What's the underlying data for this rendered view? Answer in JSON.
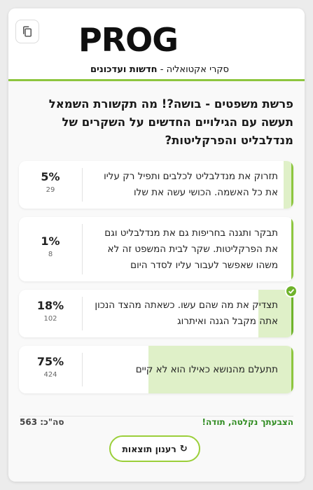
{
  "header": {
    "logo_text": "PROG",
    "tagline_main": "חדשות ועדכונים",
    "tagline_sep": " - ",
    "tagline_prefix": "סקרי אקטואליה",
    "accent_color": "#8dc63f",
    "copy_icon": "copy-icon"
  },
  "poll": {
    "question": "פרשת משפטים - בושה?! מה תקשורת השמאל תעשה עם הגילויים החדשים על השקרים של מנדלבליט והפרקליטות?",
    "answers": [
      {
        "text": "תזרוק את מנדלבליט לכלבים ותפיל רק עליו את כל האשמה. הכושי עשה את שלו",
        "percent_label": "5%",
        "votes": "29",
        "percent": 5,
        "selected": false
      },
      {
        "text": "תבקר ותגנה בחריפות גם את מנדלבליט וגם את הפרקליטות. שקר לבית המשפט זה לא משהו שאפשר לעבור עליו לסדר היום",
        "percent_label": "1%",
        "votes": "8",
        "percent": 1,
        "selected": false
      },
      {
        "text": "תצדיק את מה שהם עשו. כשאתה מהצד הנכון אתה מקבל הגנה ואיתרוג",
        "percent_label": "18%",
        "votes": "102",
        "percent": 18,
        "selected": true
      },
      {
        "text": "תתעלם מהנושא כאילו הוא לא קיים",
        "percent_label": "75%",
        "votes": "424",
        "percent": 75,
        "selected": false
      }
    ]
  },
  "footer": {
    "thanks": "הצבעתך נקלטה, תודה!",
    "total_label": "סה\"כ:",
    "total_value": "563",
    "refresh_label": "רענון תוצאות",
    "refresh_icon": "↻"
  }
}
